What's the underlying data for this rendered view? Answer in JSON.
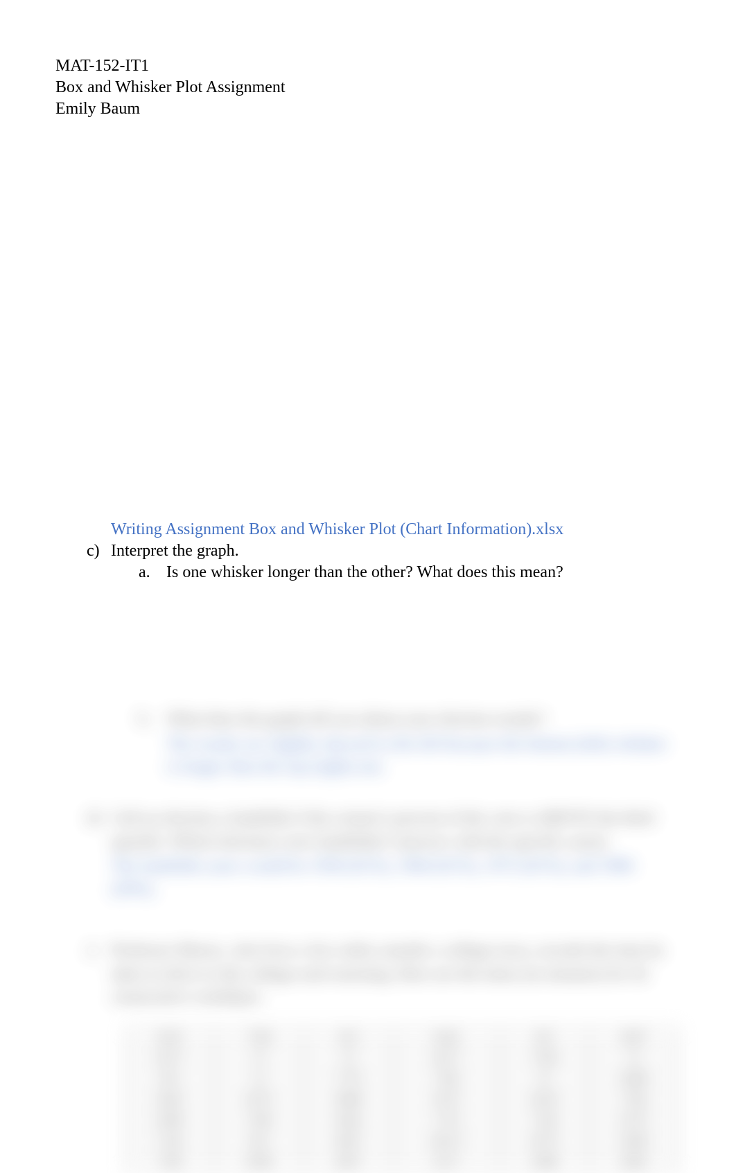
{
  "header": {
    "course": "MAT-152-IT1",
    "assignment": "Box and Whisker Plot Assignment",
    "student": "Emily Baum"
  },
  "link": {
    "text": "Writing Assignment Box and Whisker Plot (Chart Information).xlsx"
  },
  "list_c": {
    "marker": "c)",
    "text": "Interpret the graph."
  },
  "list_a": {
    "marker": "a.",
    "text": "Is one whisker longer than the other? What does this mean?"
  },
  "blurred": {
    "item_b": {
      "marker": "b.",
      "question": "What does the graph tell you about your election results?",
      "answer": "The results are slightly skewed to the left because the bottom (left) whisker is longer than the top (right) one."
    },
    "item_d": {
      "marker": "d)",
      "question": "Call an election a landslide if the winner's percent of the vote is ABOVE the third quartile. Which elections were landslides? (answer with the specific years)",
      "answer": "The landslide years would be 1936 (61%), 1964 (61%), 1972 (61%), and 1984 (59%)."
    },
    "item_2": {
      "marker": "2.",
      "text": "Professor Moore, who lives a few miles outside a college town, records the time he takes to drive to the college each morning. Here are the times (in minutes) for 42 consecutive weekdays:"
    },
    "table": {
      "rows": [
        [
          "8.25",
          "7.83",
          "8.3",
          "8.42",
          "8.5",
          "8.67"
        ],
        [
          "8.17",
          "9",
          "9",
          "8.17",
          "7.92",
          "9"
        ],
        [
          "8.5",
          "9",
          "7.75",
          "7.92",
          "8",
          "8.08"
        ],
        [
          "8.42",
          "8.75",
          "8.08",
          "9.75",
          "8.33",
          "7.92"
        ],
        [
          "8.58",
          "7.83",
          "8.42",
          "7.75",
          "7.42",
          "6.75"
        ],
        [
          "7.42",
          "8.5",
          "8.67",
          "10.17",
          "8.75",
          "8.58"
        ],
        [
          "7.83",
          "8.58",
          "8.67",
          "9.17",
          "9.08",
          "8.83"
        ]
      ]
    }
  }
}
